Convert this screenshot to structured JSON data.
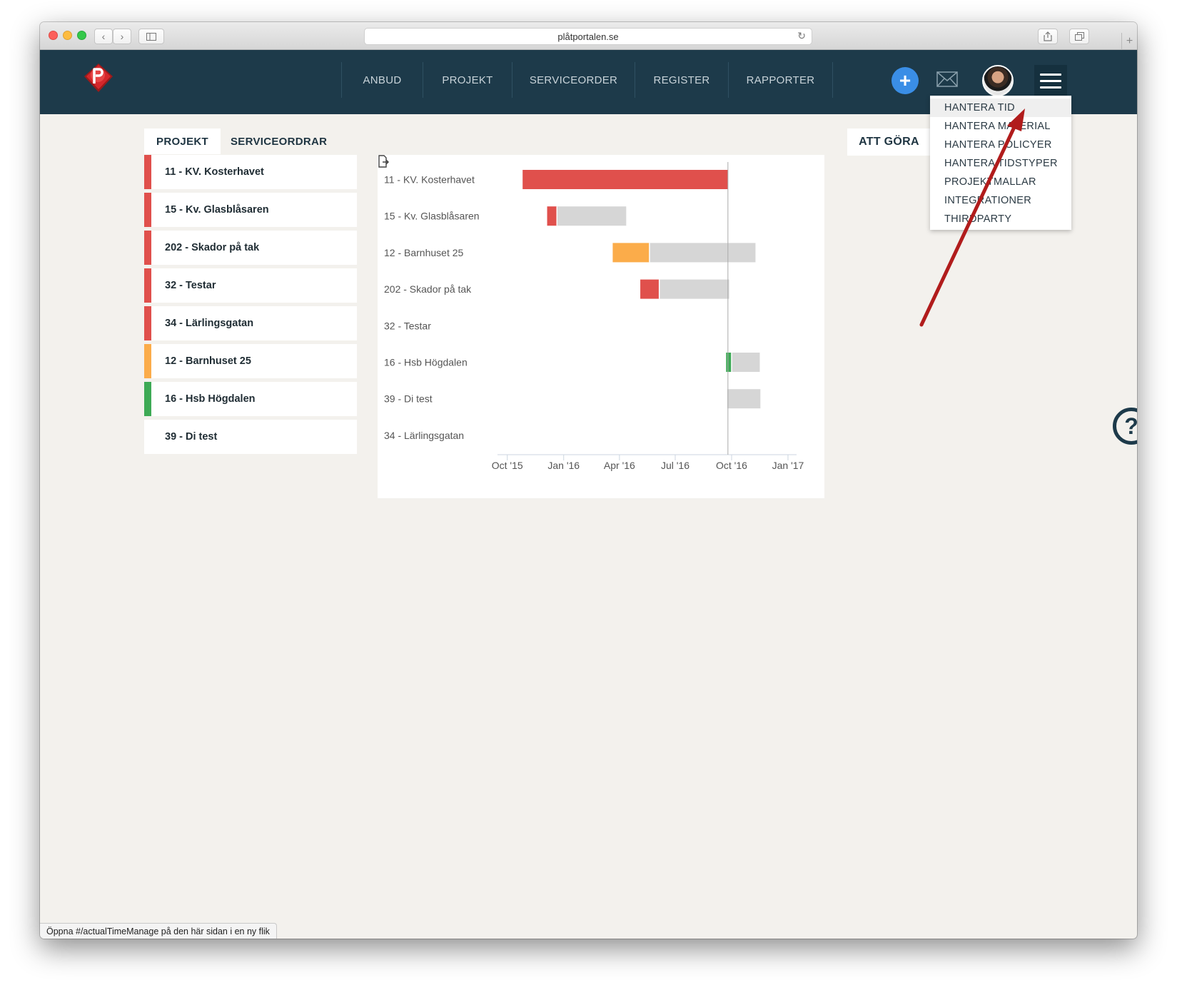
{
  "browser": {
    "url": "plåtportalen.se",
    "status_text": "Öppna #/actualTimeManage på den här sidan i en ny flik"
  },
  "nav": {
    "items": [
      "ANBUD",
      "PROJEKT",
      "SERVICEORDER",
      "REGISTER",
      "RAPPORTER"
    ],
    "plus_label": "+"
  },
  "menu": {
    "items": [
      "HANTERA TID",
      "HANTERA MATERIAL",
      "HANTERA POLICYER",
      "HANTERA TIDSTYPER",
      "PROJEKTMALLAR",
      "INTEGRATIONER",
      "THIRDPARTY"
    ],
    "active_index": 0
  },
  "tabs": {
    "projekt": "PROJEKT",
    "serviceordrar": "SERVICEORDRAR",
    "att_gora": "ATT GÖRA"
  },
  "projects": [
    {
      "label": "11 - KV. Kosterhavet",
      "color": "#e0504c"
    },
    {
      "label": "15 - Kv. Glasblåsaren",
      "color": "#e0504c"
    },
    {
      "label": "202 - Skador på tak",
      "color": "#e0504c"
    },
    {
      "label": "32 - Testar",
      "color": "#e0504c"
    },
    {
      "label": "34 - Lärlingsgatan",
      "color": "#e0504c"
    },
    {
      "label": "12 - Barnhuset 25",
      "color": "#fbac4a"
    },
    {
      "label": "16 - Hsb Högdalen",
      "color": "#3daa55"
    },
    {
      "label": "39 - Di test",
      "color": ""
    }
  ],
  "help": {
    "label": "?"
  },
  "chart_data": {
    "type": "bar",
    "orientation": "horizontal-gantt",
    "x_axis": {
      "ticks": [
        "Oct '15",
        "Jan '16",
        "Apr '16",
        "Jul '16",
        "Oct '16",
        "Jan '17"
      ],
      "range": [
        "2015-09-15",
        "2017-01-15"
      ]
    },
    "today_marker": "2016-09-25",
    "colors": {
      "red": "#e0504c",
      "orange": "#fbac4a",
      "green": "#3daa55",
      "remaining": "#d6d6d6"
    },
    "rows": [
      {
        "label": "11 - KV. Kosterhavet",
        "progress_color": "red",
        "start": "2015-10-26",
        "progress_end": "2016-09-26",
        "end": "2016-09-26"
      },
      {
        "label": "15 - Kv. Glasblåsaren",
        "progress_color": "red",
        "start": "2015-12-05",
        "progress_end": "2015-12-21",
        "end": "2016-04-12"
      },
      {
        "label": "12 - Barnhuset 25",
        "progress_color": "orange",
        "start": "2016-03-21",
        "progress_end": "2016-05-20",
        "end": "2016-11-09"
      },
      {
        "label": "202 - Skador på tak",
        "progress_color": "red",
        "start": "2016-05-05",
        "progress_end": "2016-06-05",
        "end": "2016-09-27"
      },
      {
        "label": "32 - Testar"
      },
      {
        "label": "16 - Hsb Högdalen",
        "progress_color": "green",
        "start": "2016-09-22",
        "progress_end": "2016-10-01",
        "end": "2016-11-16"
      },
      {
        "label": "39 - Di test",
        "progress_color": "green",
        "start": "2016-09-24",
        "progress_end": "2016-09-24",
        "end": "2016-11-17"
      },
      {
        "label": "34 - Lärlingsgatan"
      }
    ]
  }
}
